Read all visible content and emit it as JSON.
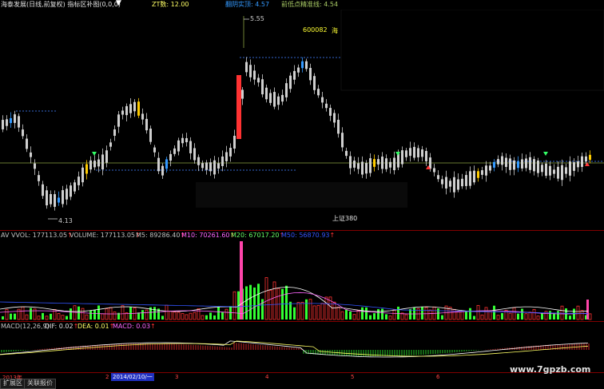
{
  "header": {
    "title": "海泰发展(日线,前复权) 指标区补图(0,0,0)",
    "zt_label": "ZT数: 12.00",
    "line1_label": "翻阴实顶: 4.57",
    "line2_label": "前低点精准线: 4.54"
  },
  "price_panel": {
    "high_label": "5.55",
    "low_label": "4.13",
    "stock_code": "600082",
    "stock_name_fragment": "海",
    "index_label": "上证380"
  },
  "volume_panel": {
    "labels": [
      {
        "text": "AV VVOL: 177113.05",
        "color": "#ffffff"
      },
      {
        "text": "VOLUME: 177113.05",
        "color": "#ffffff"
      },
      {
        "text": "M5: 89286.40",
        "color": "#ffffff"
      },
      {
        "text": "M10: 70261.60",
        "color": "#ff66ff"
      },
      {
        "text": "M20: 67017.20",
        "color": "#66ff66"
      },
      {
        "text": "M50: 56870.93",
        "color": "#3355ff"
      }
    ]
  },
  "macd_panel": {
    "name": "MACD(12,26,9)",
    "dif": "DIF: 0.02",
    "dea": "DEA: 0.01",
    "macd": "MACD: 0.03"
  },
  "time_axis": {
    "year_label": "2013年",
    "date_label": "2014/02/10/一",
    "month_ticks": [
      "2",
      "3",
      "4",
      "5",
      "6"
    ]
  },
  "bottom_tabs": [
    "扩展区",
    "关联报价"
  ],
  "watermark": "www.7gpzb.com",
  "colors": {
    "up": "#ff3232",
    "down": "#d0d0d0",
    "limit_up": "#ff3232",
    "yellow": "#ffcc00",
    "blue": "#3399ff",
    "green_vol": "#33ff33",
    "pink_vol": "#ff44aa"
  }
}
